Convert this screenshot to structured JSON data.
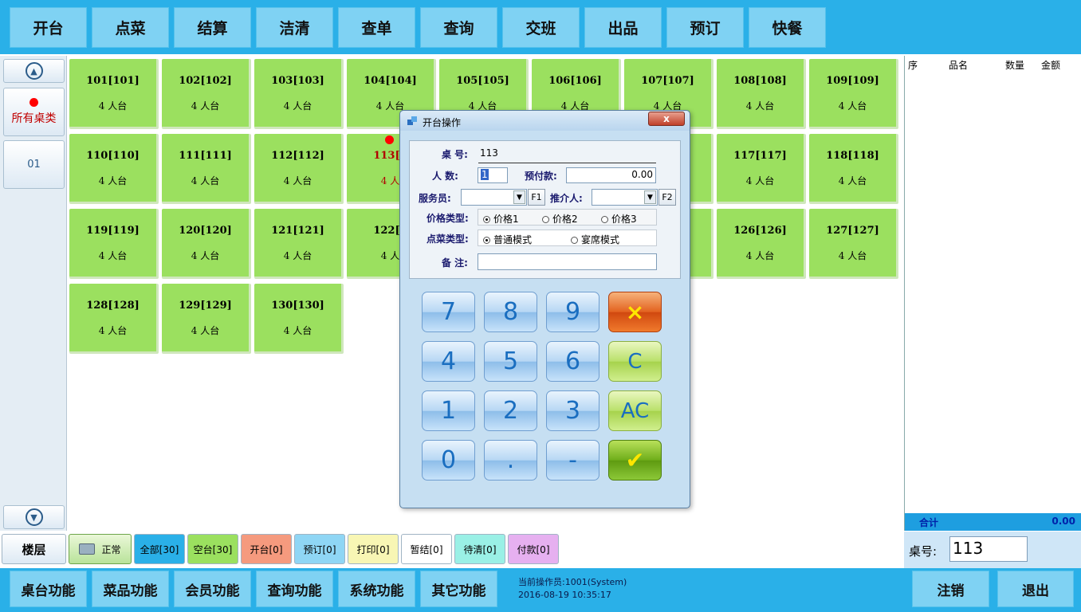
{
  "top_menu": [
    "开台",
    "点菜",
    "结算",
    "洁清",
    "查单",
    "查询",
    "交班",
    "出品",
    "预订",
    "快餐"
  ],
  "sidebar": {
    "categories": [
      {
        "label": "所有桌类",
        "selected": true
      },
      {
        "label": "01",
        "selected": false
      }
    ]
  },
  "tables": [
    {
      "name": "101[101]",
      "seats": "4 人台"
    },
    {
      "name": "102[102]",
      "seats": "4 人台"
    },
    {
      "name": "103[103]",
      "seats": "4 人台"
    },
    {
      "name": "104[104]",
      "seats": "4 人台"
    },
    {
      "name": "105[105]",
      "seats": "4 人台"
    },
    {
      "name": "106[106]",
      "seats": "4 人台"
    },
    {
      "name": "107[107]",
      "seats": "4 人台"
    },
    {
      "name": "108[108]",
      "seats": "4 人台"
    },
    {
      "name": "109[109]",
      "seats": "4 人台"
    },
    {
      "name": "110[110]",
      "seats": "4 人台"
    },
    {
      "name": "111[111]",
      "seats": "4 人台"
    },
    {
      "name": "112[112]",
      "seats": "4 人台"
    },
    {
      "name": "113[1",
      "seats": "4 人",
      "active": true
    },
    {
      "name": "",
      "seats": ""
    },
    {
      "name": "",
      "seats": ""
    },
    {
      "name": "",
      "seats": ""
    },
    {
      "name": "117[117]",
      "seats": "4 人台"
    },
    {
      "name": "118[118]",
      "seats": "4 人台"
    },
    {
      "name": "119[119]",
      "seats": "4 人台"
    },
    {
      "name": "120[120]",
      "seats": "4 人台"
    },
    {
      "name": "121[121]",
      "seats": "4 人台"
    },
    {
      "name": "122[1",
      "seats": "4 人"
    },
    {
      "name": "",
      "seats": ""
    },
    {
      "name": "",
      "seats": ""
    },
    {
      "name": "",
      "seats": ""
    },
    {
      "name": "126[126]",
      "seats": "4 人台"
    },
    {
      "name": "127[127]",
      "seats": "4 人台"
    },
    {
      "name": "128[128]",
      "seats": "4 人台"
    },
    {
      "name": "129[129]",
      "seats": "4 人台"
    },
    {
      "name": "130[130]",
      "seats": "4 人台"
    }
  ],
  "order_panel": {
    "col_seq": "序",
    "col_name": "品名",
    "col_qty": "数量",
    "col_amount": "金额",
    "total_label": "合计",
    "total_value": "0.00",
    "table_no_label": "桌号:",
    "table_no_value": "113"
  },
  "filters": {
    "floor": "楼层",
    "normal": "正常",
    "items": [
      {
        "label": "全部[30]",
        "color": "#2ab0e8"
      },
      {
        "label": "空台[30]",
        "color": "#9be05f"
      },
      {
        "label": "开台[0]",
        "color": "#f59a7e"
      },
      {
        "label": "预订[0]",
        "color": "#8fd6f5"
      },
      {
        "label": "打印[0]",
        "color": "#f8f6b4"
      },
      {
        "label": "暂结[0]",
        "color": "#ffffff"
      },
      {
        "label": "待清[0]",
        "color": "#9af0e6"
      },
      {
        "label": "付款[0]",
        "color": "#e6b0f0"
      }
    ]
  },
  "bottom_menu": [
    "桌台功能",
    "菜品功能",
    "会员功能",
    "查询功能",
    "系统功能",
    "其它功能"
  ],
  "status": {
    "operator": "当前操作员:1001(System)",
    "datetime": "2016-08-19 10:35:17"
  },
  "bottom_right": [
    "注销",
    "退出"
  ],
  "dialog": {
    "title": "开台操作",
    "close": "x",
    "table_label": "桌 号:",
    "table_value": "113",
    "people_label": "人 数:",
    "people_value": "1",
    "deposit_label": "预付款:",
    "deposit_value": "0.00",
    "waiter_label": "服务员:",
    "waiter_key": "F1",
    "referrer_label": "推介人:",
    "referrer_key": "F2",
    "price_type_label": "价格类型:",
    "price_options": [
      "价格1",
      "价格2",
      "价格3"
    ],
    "order_type_label": "点菜类型:",
    "order_options": [
      "普通模式",
      "宴席模式"
    ],
    "remark_label": "备 注:",
    "keys": [
      "7",
      "8",
      "9",
      "×",
      "4",
      "5",
      "6",
      "C",
      "1",
      "2",
      "3",
      "AC",
      "0",
      ".",
      "-",
      "✔"
    ]
  }
}
